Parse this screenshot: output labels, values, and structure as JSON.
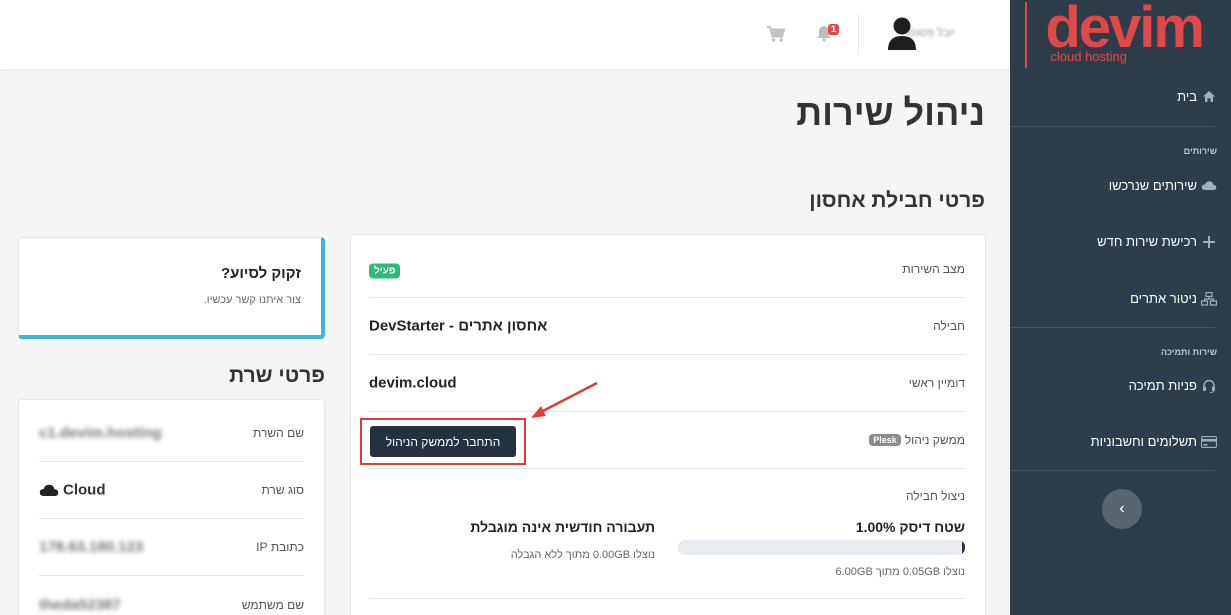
{
  "brand": {
    "name": "devim",
    "tagline": "cloud hosting",
    "color": "#e24848"
  },
  "topbar": {
    "username": "יובל פסגסו",
    "notifications_count": "1"
  },
  "sidebar": {
    "items": [
      {
        "label": "בית",
        "icon": "home-icon"
      },
      {
        "label": "שירותים שנרכשו",
        "icon": "cloud-icon"
      },
      {
        "label": "רכישת שירות חדש",
        "icon": "plus-icon"
      },
      {
        "label": "ניטור אתרים",
        "icon": "network-icon"
      },
      {
        "label": "פניות תמיכה",
        "icon": "headset-icon"
      },
      {
        "label": "תשלומים וחשבוניות",
        "icon": "credit-card-icon"
      }
    ],
    "sections": {
      "services": "שירותים",
      "services_support": "שירות ותמיכה"
    },
    "collapse_glyph": "›"
  },
  "page": {
    "title": "ניהול שירות",
    "subtitle": "פרטי חבילת אחסון"
  },
  "service": {
    "status_label": "מצב השירות",
    "status_value": "פעיל",
    "package_label": "חבילה",
    "package_value": "אחסון אתרים - DevStarter",
    "domain_label": "דומיין ראשי",
    "domain_value": "devim.cloud",
    "panel_label": "ממשק ניהול",
    "panel_badge": "Plesk",
    "connect_button": "התחבר לממשק הניהול",
    "usage_label": "ניצול חבילה",
    "disk_title": "שטח דיסק 1.00%",
    "disk_percent": 1.0,
    "disk_sub": "נוצלו 0.05GB מתוך 6.00GB",
    "traffic_title": "תעבורה חודשית אינה מוגבלת",
    "traffic_sub": "נוצלו 0.00GB מתוך ללא הגבלה"
  },
  "help": {
    "title": "זקוק לסיוע?",
    "subtitle": "צור איתנו קשר עכשיו."
  },
  "server": {
    "title": "פרטי שרת",
    "rows": [
      {
        "label": "שם השרת",
        "value": "c1.devim.hosting"
      },
      {
        "label": "סוג שרת",
        "value": "Cloud"
      },
      {
        "label": "כתובת IP",
        "value": "178.63.180.123"
      },
      {
        "label": "שם משתמש",
        "value": "theda52387"
      }
    ]
  }
}
